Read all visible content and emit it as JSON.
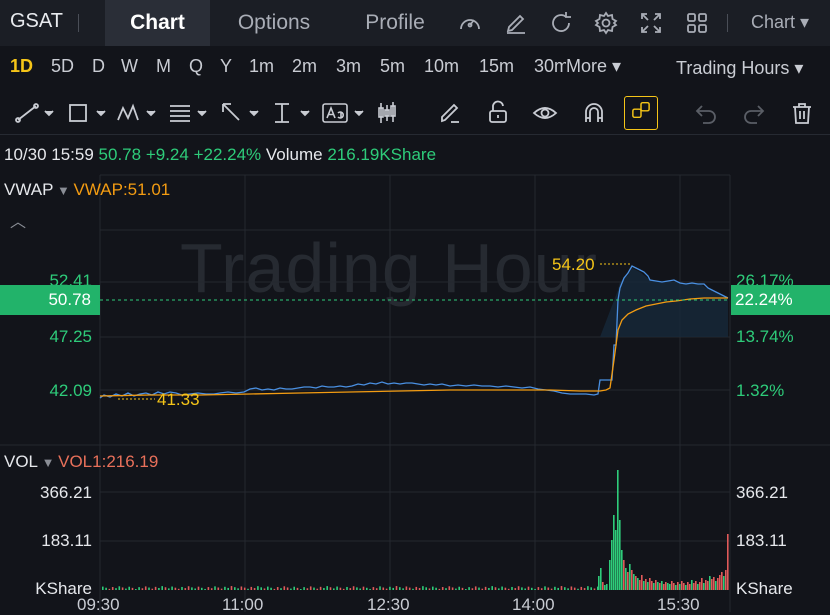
{
  "header": {
    "ticker": "GSAT",
    "tabs": [
      {
        "label": "Chart",
        "active": true
      },
      {
        "label": "Options",
        "active": false
      },
      {
        "label": "Profile",
        "active": false
      }
    ],
    "chart_menu": "Chart"
  },
  "periods": {
    "items": [
      "1D",
      "5D",
      "D",
      "W",
      "M",
      "Q",
      "Y",
      "1m",
      "2m",
      "3m",
      "5m",
      "10m",
      "15m",
      "30m"
    ],
    "active": "1D",
    "more": "More",
    "trading_hours": "Trading Hours"
  },
  "quote": {
    "datetime": "10/30 15:59",
    "price": "50.78",
    "change": "+9.24",
    "change_pct": "+22.24%",
    "volume_label": "Volume",
    "volume": "216.19KShare"
  },
  "price_panel": {
    "indicator": "VWAP",
    "indicator_value": "VWAP:51.01",
    "watermark": "Trading Hour",
    "left_axis": [
      "52.41",
      "47.25",
      "42.09"
    ],
    "right_axis": [
      "26.17%",
      "13.74%",
      "1.32%"
    ],
    "current_price": "50.78",
    "current_pct": "22.24%",
    "high_label": "54.20",
    "low_label": "41.33"
  },
  "volume_panel": {
    "indicator": "VOL",
    "indicator_value": "VOL1:216.19",
    "left_axis": [
      "366.21",
      "183.11",
      "KShare"
    ],
    "right_axis": [
      "366.21",
      "183.11",
      "KShare"
    ]
  },
  "time_axis": [
    "09:30",
    "11:00",
    "12:30",
    "14:00",
    "15:30"
  ],
  "colors": {
    "up": "#2ecc7a",
    "down": "#e05a5a",
    "vwap": "#f39c12",
    "price_line": "#4a90e2",
    "accent": "#f5c518"
  }
}
